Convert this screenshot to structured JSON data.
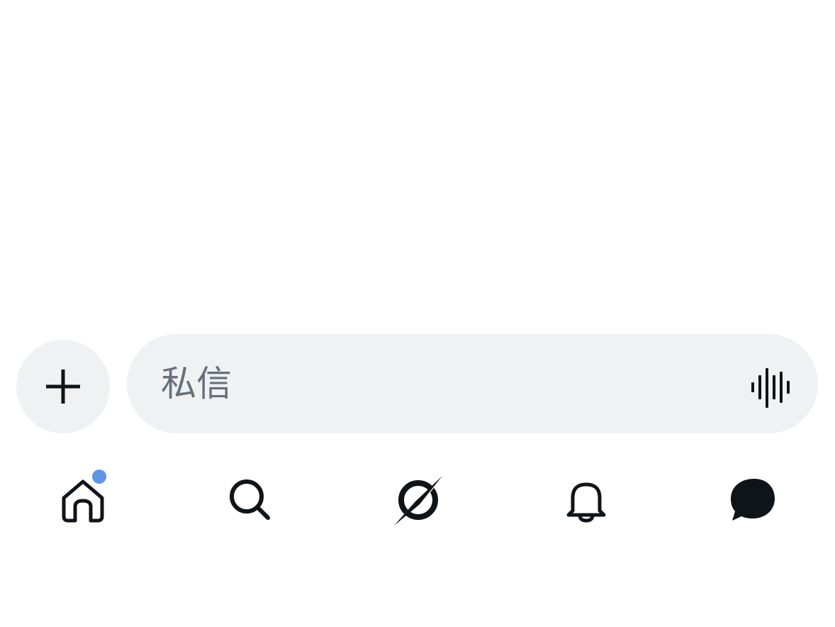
{
  "composer": {
    "placeholder": "私信",
    "value": "",
    "add_icon": "plus-icon",
    "voice_icon": "audio-waveform-icon"
  },
  "tab_bar": {
    "items": [
      {
        "id": "home",
        "icon": "home-icon",
        "active": false,
        "badge": true
      },
      {
        "id": "search",
        "icon": "search-icon",
        "active": false,
        "badge": false
      },
      {
        "id": "grok",
        "icon": "grok-icon",
        "active": false,
        "badge": false
      },
      {
        "id": "notifications",
        "icon": "bell-icon",
        "active": false,
        "badge": false
      },
      {
        "id": "messages",
        "icon": "message-bubble-icon",
        "active": true,
        "badge": false
      }
    ]
  },
  "colors": {
    "background": "#ffffff",
    "input_fill": "#eff1f3",
    "placeholder": "#66707a",
    "icon": "#0f1419",
    "badge": "#5e96e6"
  }
}
